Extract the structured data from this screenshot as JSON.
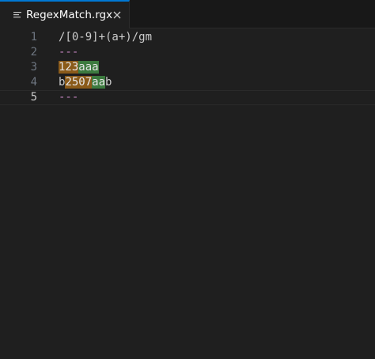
{
  "tab": {
    "title": "RegexMatch.rgx",
    "icon": "lines-icon",
    "close_icon": "close-icon",
    "accent_color": "#0078d4"
  },
  "editor": {
    "lines": [
      {
        "number": "1",
        "text": "/[0-9]+(a+)/gm"
      },
      {
        "number": "2",
        "text": "---"
      },
      {
        "number": "3",
        "before": "",
        "digits": "123",
        "group": "aaa",
        "after": ""
      },
      {
        "number": "4",
        "before": "b",
        "digits": "2507",
        "group": "aa",
        "after": "b"
      },
      {
        "number": "5",
        "text": "---"
      }
    ],
    "active_line": "5",
    "colors": {
      "digits_match": "#8a5a19",
      "group_match": "#3c7a3f",
      "separator": "#c586c0"
    }
  }
}
